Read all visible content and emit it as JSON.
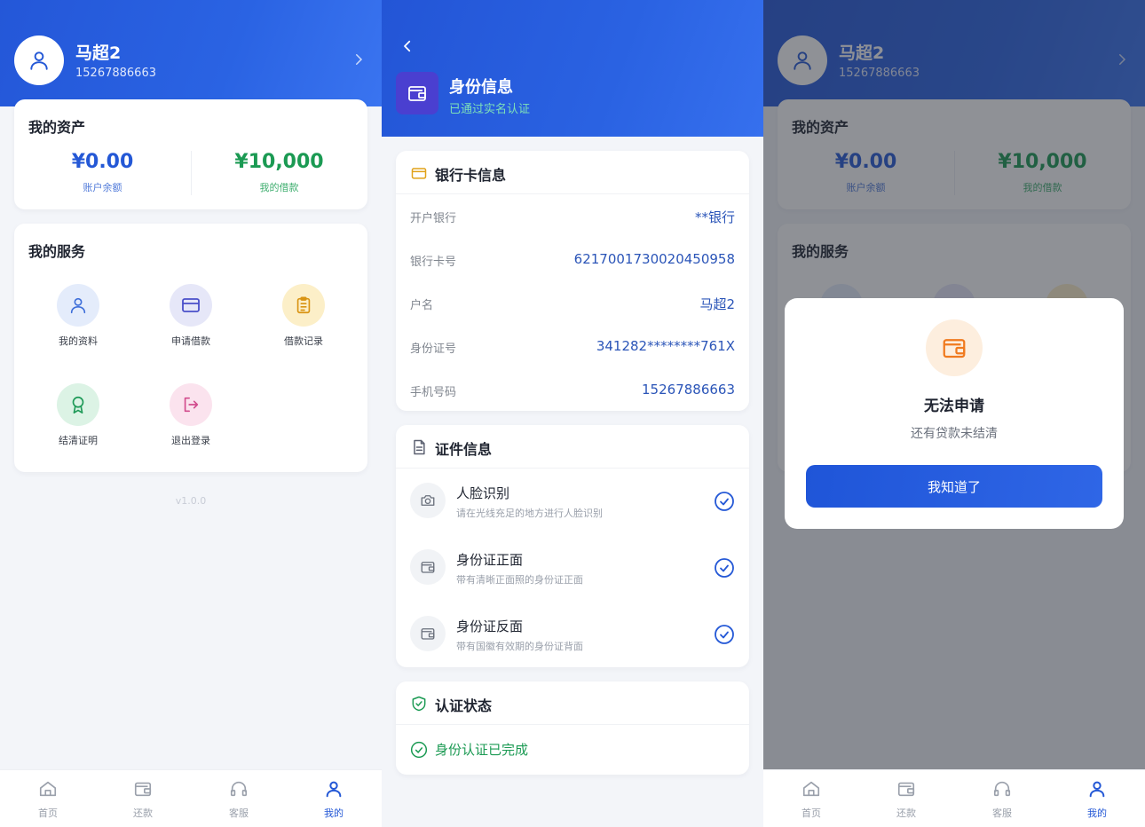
{
  "profile": {
    "name": "马超2",
    "phone": "15267886663",
    "assets": {
      "title": "我的资产",
      "balance_value": "¥0.00",
      "balance_label": "账户余额",
      "loan_value": "¥10,000",
      "loan_label": "我的借款"
    },
    "services": {
      "title": "我的服务",
      "items": [
        {
          "label": "我的资料",
          "icon": "user-icon"
        },
        {
          "label": "申请借款",
          "icon": "card-icon"
        },
        {
          "label": "借款记录",
          "icon": "clipboard-icon"
        },
        {
          "label": "结清证明",
          "icon": "award-icon"
        },
        {
          "label": "退出登录",
          "icon": "logout-icon"
        }
      ]
    },
    "version": "v1.0.0"
  },
  "tabbar": {
    "items": [
      {
        "label": "首页",
        "icon": "home-icon"
      },
      {
        "label": "还款",
        "icon": "wallet-icon"
      },
      {
        "label": "客服",
        "icon": "headset-icon"
      },
      {
        "label": "我的",
        "icon": "user-icon",
        "active": true
      }
    ]
  },
  "identity": {
    "title": "身份信息",
    "subtitle": "已通过实名认证",
    "bank": {
      "title": "银行卡信息",
      "rows": [
        {
          "label": "开户银行",
          "value": "**银行"
        },
        {
          "label": "银行卡号",
          "value": "6217001730020450958"
        },
        {
          "label": "户名",
          "value": "马超2"
        },
        {
          "label": "身份证号",
          "value": "341282********761X"
        },
        {
          "label": "手机号码",
          "value": "15267886663"
        }
      ]
    },
    "documents": {
      "title": "证件信息",
      "items": [
        {
          "name": "人脸识别",
          "desc": "请在光线充足的地方进行人脸识别",
          "icon": "camera-icon"
        },
        {
          "name": "身份证正面",
          "desc": "带有清晰正面照的身份证正面",
          "icon": "wallet-icon"
        },
        {
          "name": "身份证反面",
          "desc": "带有国徽有效期的身份证背面",
          "icon": "wallet-icon"
        }
      ]
    },
    "status": {
      "title": "认证状态",
      "text": "身份认证已完成"
    }
  },
  "modal": {
    "title": "无法申请",
    "desc": "还有贷款未结清",
    "button": "我知道了"
  },
  "colors": {
    "primary": "#2458d6",
    "balance": "#2458d6",
    "loan": "#1b9a53",
    "success": "#1b9a53"
  }
}
